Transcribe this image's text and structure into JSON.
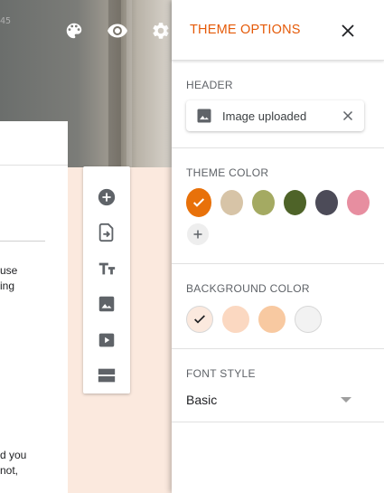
{
  "window": {
    "top_icons": [
      "palette-icon",
      "eye-icon",
      "gear-icon"
    ],
    "background_tag": "45"
  },
  "form_snippets": [
    "use",
    "ing",
    "d you",
    "not,"
  ],
  "toolbar": {
    "items": [
      "add-question-icon",
      "import-questions-icon",
      "add-title-icon",
      "add-image-icon",
      "add-video-icon",
      "add-section-icon"
    ]
  },
  "theme_panel": {
    "title": "THEME OPTIONS",
    "header": {
      "label": "HEADER",
      "chip_label": "Image uploaded"
    },
    "theme_color": {
      "label": "THEME COLOR",
      "selected": "#e8710a",
      "swatches": [
        "#e8710a",
        "#d7c4a7",
        "#a4aa62",
        "#4e6328",
        "#4c4b58",
        "#e78ea0"
      ]
    },
    "background_color": {
      "label": "BACKGROUND COLOR",
      "selected": "#fbe9de",
      "swatches": [
        "#fbe9de",
        "#fbd8c1",
        "#f8c9a1",
        "#f2f2f2"
      ]
    },
    "font_style": {
      "label": "FONT STYLE",
      "value": "Basic"
    }
  },
  "colors": {
    "accent": "#e55a08",
    "page_background": "#fbe9de"
  }
}
